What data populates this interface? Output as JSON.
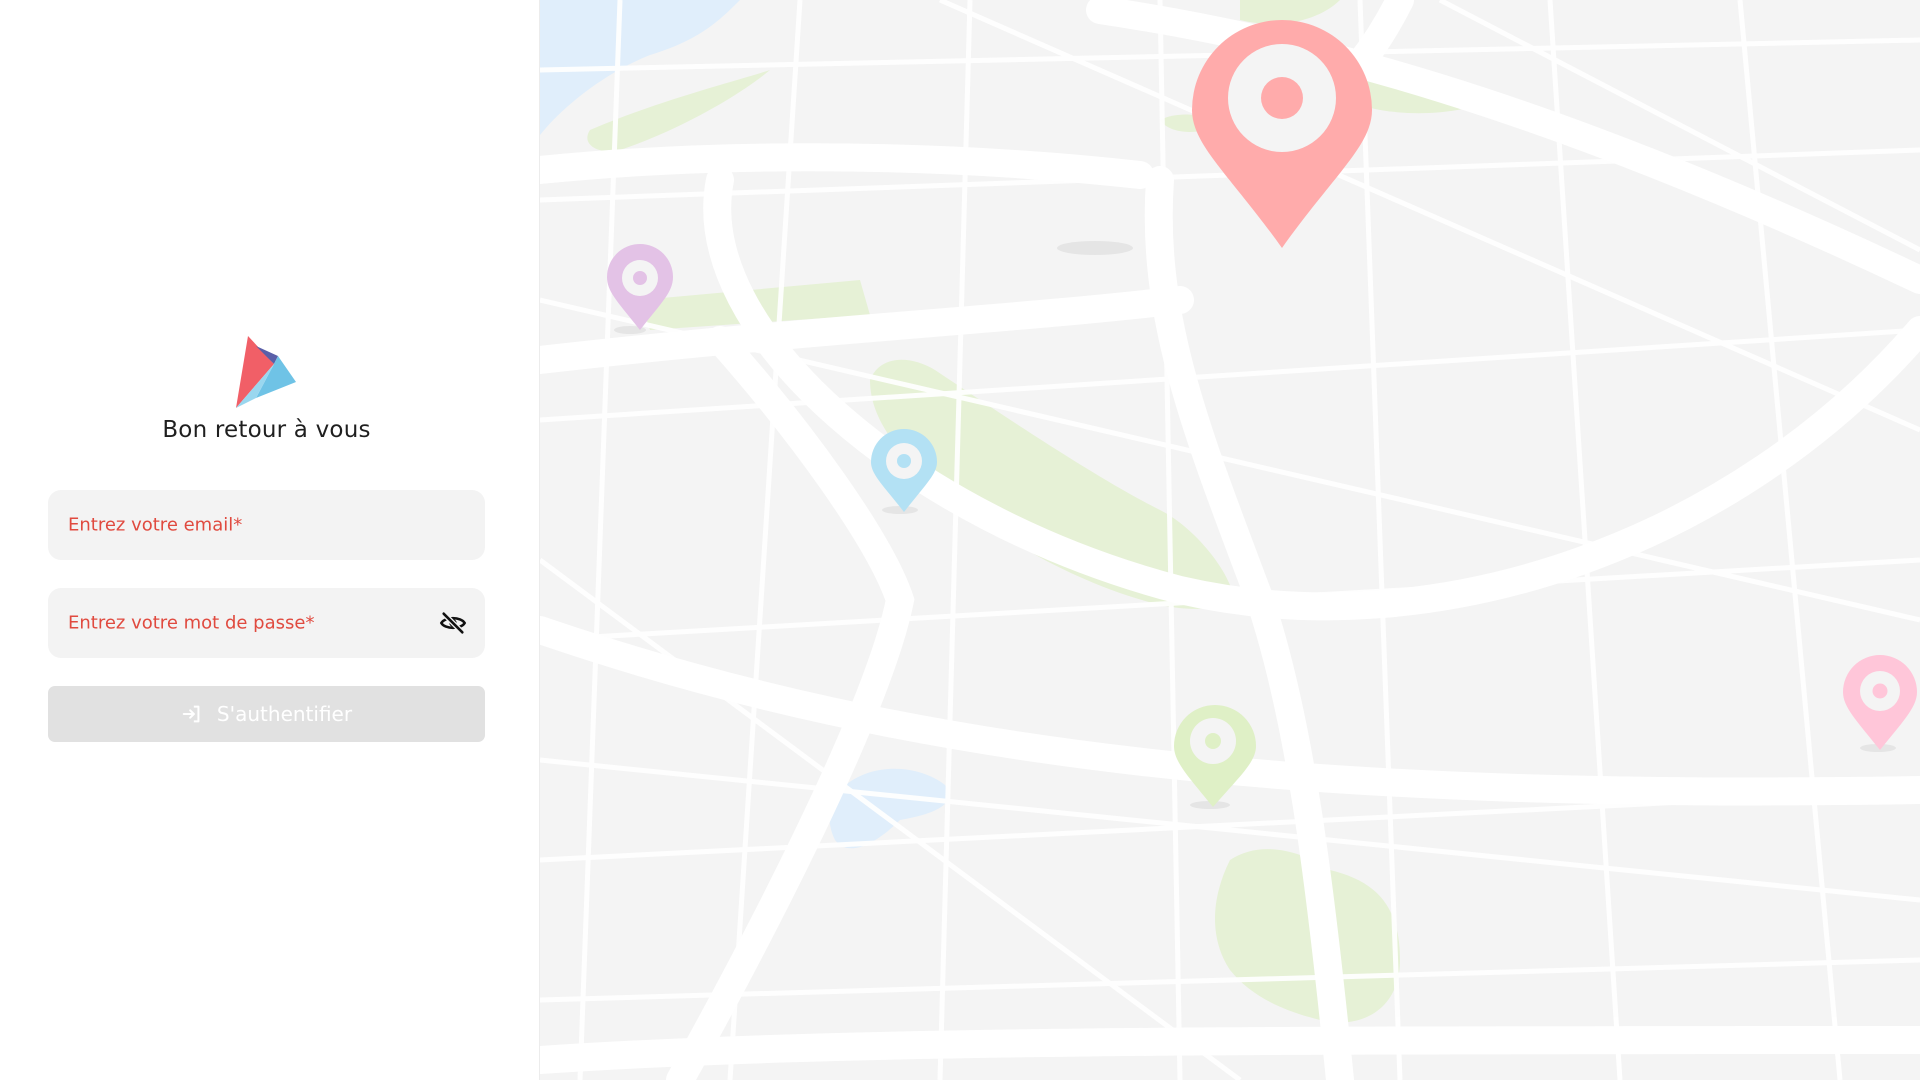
{
  "login": {
    "welcome_title": "Bon retour à vous",
    "email": {
      "label": "Entrez votre email*",
      "value": ""
    },
    "password": {
      "label": "Entrez votre mot de passe*",
      "value": "",
      "visibility_icon": "eye-off-icon"
    },
    "submit": {
      "label": "S'authentifier",
      "icon": "login-icon",
      "enabled": false
    }
  },
  "map": {
    "pins": [
      {
        "color": "#ffabab",
        "icon": "map-pin-icon"
      },
      {
        "color": "#e3c2e6",
        "icon": "map-pin-icon"
      },
      {
        "color": "#b3e1f4",
        "icon": "map-pin-icon"
      },
      {
        "color": "#dff0c6",
        "icon": "map-pin-icon"
      },
      {
        "color": "#ffc6d9",
        "icon": "map-pin-icon"
      }
    ]
  },
  "colors": {
    "label_red": "#e04a3f",
    "field_bg": "#f3f3f3",
    "button_disabled": "#e1e1e1",
    "park_green": "#e6f1d6",
    "water_blue": "#e0eefb"
  }
}
